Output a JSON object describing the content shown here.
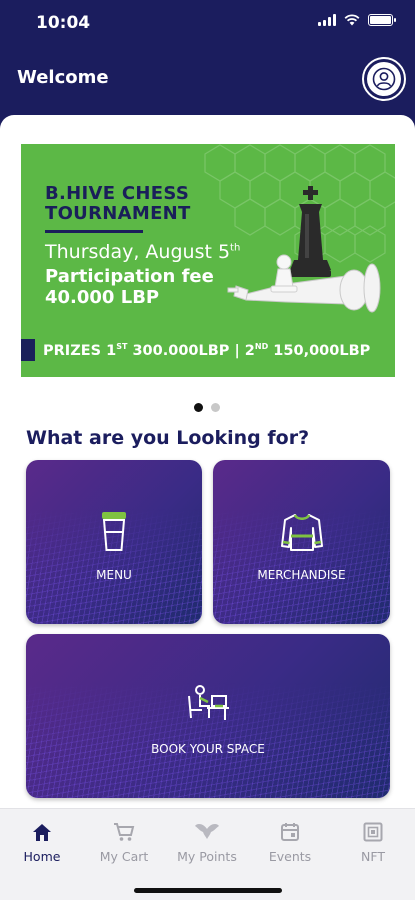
{
  "status_bar": {
    "time": "10:04"
  },
  "header": {
    "title": "Welcome"
  },
  "banner": {
    "title_line1": "B.HIVE CHESS",
    "title_line2": "TOURNAMENT",
    "date_prefix": "Thursday, August 5",
    "date_suffix": "th",
    "fee_label": "Participation fee",
    "fee_value": "40.000 LBP",
    "prize_part1": "PRIZES 1",
    "prize_sup1": "ST",
    "prize_part2": " 300.000LBP | 2",
    "prize_sup2": "ND",
    "prize_part3": " 150,000LBP",
    "accent": "#5cb846"
  },
  "carousel": {
    "count": 2,
    "active_index": 0
  },
  "section": {
    "title": "What are you Looking for?"
  },
  "tiles": [
    {
      "label": "MENU",
      "icon": "coffee-cup-icon"
    },
    {
      "label": "MERCHANDISE",
      "icon": "sweater-icon"
    },
    {
      "label": "BOOK YOUR SPACE",
      "icon": "workspace-desk-icon"
    }
  ],
  "nav": {
    "items": [
      {
        "label": "Home",
        "icon": "home-icon",
        "active": true
      },
      {
        "label": "My Cart",
        "icon": "cart-icon",
        "active": false
      },
      {
        "label": "My Points",
        "icon": "points-icon",
        "active": false
      },
      {
        "label": "Events",
        "icon": "calendar-icon",
        "active": false
      },
      {
        "label": "NFT",
        "icon": "nft-icon",
        "active": false
      }
    ]
  },
  "colors": {
    "primary": "#1b1d5e",
    "tile": "#3a2b86"
  }
}
